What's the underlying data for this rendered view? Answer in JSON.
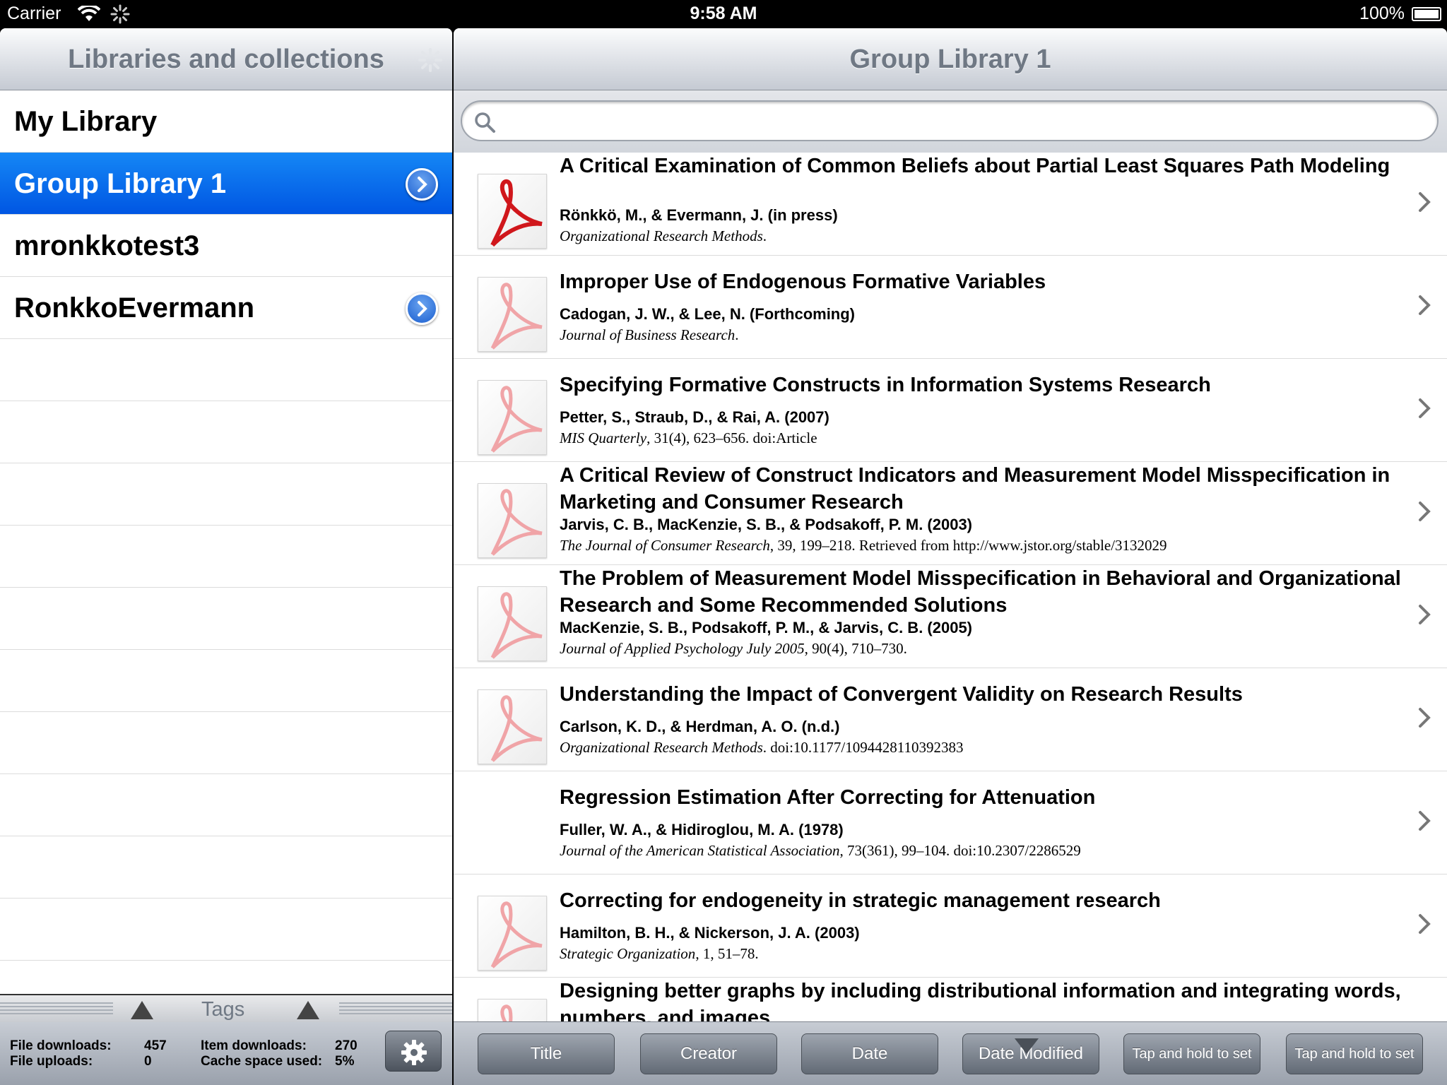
{
  "status": {
    "carrier": "Carrier",
    "time": "9:58 AM",
    "battery": "100%"
  },
  "left": {
    "title": "Libraries and collections",
    "libraries": [
      {
        "label": "My Library",
        "selected": false,
        "disclosure": false
      },
      {
        "label": "Group Library 1",
        "selected": true,
        "disclosure": true
      },
      {
        "label": "mronkkotest3",
        "selected": false,
        "disclosure": false
      },
      {
        "label": "RonkkoEvermann",
        "selected": false,
        "disclosure": true
      }
    ],
    "tags_label": "Tags",
    "stats": {
      "file_downloads_label": "File downloads:",
      "file_downloads": "457",
      "file_uploads_label": "File uploads:",
      "file_uploads": "0",
      "item_downloads_label": "Item downloads:",
      "item_downloads": "270",
      "cache_label": "Cache space used:",
      "cache": "5%"
    }
  },
  "right": {
    "title": "Group Library 1",
    "search": {
      "placeholder": "",
      "value": ""
    },
    "items": [
      {
        "title": "A Critical Examination of Common Beliefs about Partial Least Squares Path Modeling",
        "authors": "Rönkkö, M.,  & Evermann, J. (in press)",
        "journal": "Organizational Research Methods",
        "rest": ".",
        "pdf": "active"
      },
      {
        "title": "Improper Use of Endogenous Formative Variables",
        "authors": "Cadogan, J. W.,  & Lee, N. (Forthcoming)",
        "journal": "Journal of Business Research",
        "rest": ".",
        "pdf": "faded"
      },
      {
        "title": "Specifying Formative Constructs in Information Systems Research",
        "authors": "Petter, S., Straub, D.,  & Rai, A. (2007)",
        "journal": "MIS Quarterly",
        "rest": ", 31(4), 623–656. doi:Article",
        "pdf": "faded"
      },
      {
        "title": "A Critical Review of Construct Indicators and Measurement Model Misspecification in Marketing and Consumer Research",
        "authors": "Jarvis, C. B., MacKenzie, S. B.,  & Podsakoff, P. M. (2003)",
        "journal": "The Journal of Consumer Research",
        "rest": ", 39, 199–218. Retrieved from http://www.jstor.org/stable/3132029",
        "pdf": "faded"
      },
      {
        "title": "The Problem of Measurement Model Misspecification in Behavioral and Organizational Research and Some Recommended Solutions",
        "authors": "MacKenzie, S. B., Podsakoff, P. M.,  & Jarvis, C. B. (2005)",
        "journal": "Journal of Applied Psychology July 2005",
        "rest": ", 90(4), 710–730.",
        "pdf": "faded"
      },
      {
        "title": "Understanding the Impact of Convergent Validity on Research Results",
        "authors": "Carlson, K. D.,  & Herdman, A. O. (n.d.)",
        "journal": "Organizational Research Methods",
        "rest": ". doi:10.1177/1094428110392383",
        "pdf": "faded"
      },
      {
        "title": "Regression Estimation After Correcting for Attenuation",
        "authors": "Fuller, W. A.,  & Hidiroglou, M. A. (1978)",
        "journal": "Journal of the American Statistical Association",
        "rest": ", 73(361), 99–104. doi:10.2307/2286529",
        "pdf": "none"
      },
      {
        "title": "Correcting for endogeneity in strategic management research",
        "authors": "Hamilton, B. H.,  & Nickerson, J. A. (2003)",
        "journal": "Strategic Organization",
        "rest": ", 1, 51–78.",
        "pdf": "faded"
      },
      {
        "title": "Designing better graphs by including distributional information and integrating words, numbers, and images",
        "authors": "",
        "journal": "",
        "rest": "",
        "pdf": "faded"
      }
    ],
    "sort_buttons": [
      "Title",
      "Creator",
      "Date",
      "Date Modified",
      "Tap and hold to set",
      "Tap and hold to set"
    ]
  }
}
